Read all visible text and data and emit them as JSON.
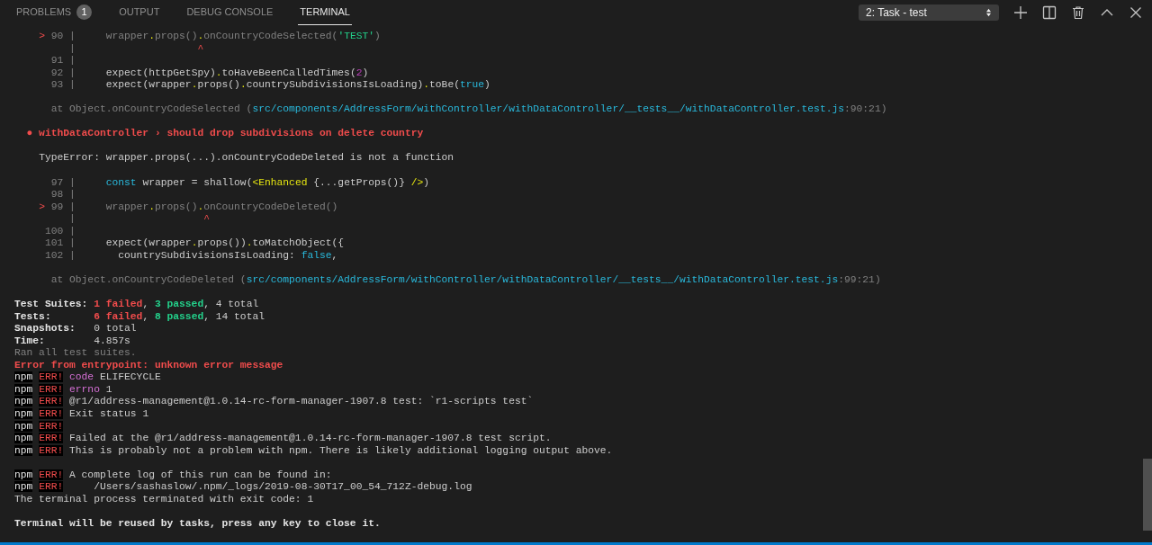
{
  "panel_tabs": [
    {
      "label": "PROBLEMS",
      "badge": "1",
      "selected": false
    },
    {
      "label": "OUTPUT",
      "selected": false
    },
    {
      "label": "DEBUG CONSOLE",
      "selected": false
    },
    {
      "label": "TERMINAL",
      "selected": true
    }
  ],
  "terminal_select": {
    "value": "2: Task - test"
  },
  "terminal_lines": [
    {
      "kind": "text",
      "segments": [
        {
          "kind": "marker",
          "text": "    >"
        },
        {
          "kind": "lineno",
          "text": " 90"
        },
        {
          "kind": "gutter",
          "text": " |"
        },
        {
          "kind": "dimcode",
          "text": "     wrapper"
        },
        {
          "kind": "punct",
          "text": "."
        },
        {
          "kind": "dimcode",
          "text": "props()"
        },
        {
          "kind": "punct",
          "text": "."
        },
        {
          "kind": "dimcode",
          "text": "onCountryCodeSelected("
        },
        {
          "kind": "str",
          "text": "'TEST'"
        },
        {
          "kind": "dimcode",
          "text": ")"
        }
      ]
    },
    {
      "kind": "text",
      "segments": [
        {
          "kind": "gutter",
          "text": "         |"
        },
        {
          "kind": "marker",
          "text": "                    ^"
        }
      ]
    },
    {
      "kind": "text",
      "segments": [
        {
          "kind": "lineno",
          "text": "      91"
        },
        {
          "kind": "gutter",
          "text": " |"
        }
      ]
    },
    {
      "kind": "text",
      "segments": [
        {
          "kind": "lineno",
          "text": "      92"
        },
        {
          "kind": "gutter",
          "text": " |"
        },
        {
          "kind": "code",
          "text": "     expect(httpGetSpy)"
        },
        {
          "kind": "punct",
          "text": "."
        },
        {
          "kind": "code",
          "text": "toHaveBeenCalledTimes("
        },
        {
          "kind": "num",
          "text": "2"
        },
        {
          "kind": "code",
          "text": ")"
        }
      ]
    },
    {
      "kind": "text",
      "segments": [
        {
          "kind": "lineno",
          "text": "      93"
        },
        {
          "kind": "gutter",
          "text": " |"
        },
        {
          "kind": "code",
          "text": "     expect(wrapper"
        },
        {
          "kind": "punct",
          "text": "."
        },
        {
          "kind": "code",
          "text": "props()"
        },
        {
          "kind": "punct",
          "text": "."
        },
        {
          "kind": "code",
          "text": "countrySubdivisionsIsLoading)"
        },
        {
          "kind": "punct",
          "text": "."
        },
        {
          "kind": "code",
          "text": "toBe("
        },
        {
          "kind": "kw",
          "text": "true"
        },
        {
          "kind": "code",
          "text": ")"
        }
      ]
    },
    {
      "kind": "blank"
    },
    {
      "kind": "text",
      "segments": [
        {
          "kind": "dim",
          "text": "      at Object.onCountryCodeSelected ("
        },
        {
          "kind": "path",
          "text": "src/components/AddressForm/withController/withDataController/__tests__/withDataController.test.js"
        },
        {
          "kind": "dim",
          "text": ":90:21)"
        }
      ]
    },
    {
      "kind": "blank"
    },
    {
      "kind": "text",
      "segments": [
        {
          "kind": "redb",
          "text": "  ● withDataController › should drop subdivisions on delete country"
        }
      ]
    },
    {
      "kind": "blank"
    },
    {
      "kind": "text",
      "segments": [
        {
          "kind": "plain",
          "text": "    TypeError: wrapper.props(...).onCountryCodeDeleted is not a function"
        }
      ]
    },
    {
      "kind": "blank"
    },
    {
      "kind": "text",
      "segments": [
        {
          "kind": "lineno",
          "text": "      97"
        },
        {
          "kind": "gutter",
          "text": " |"
        },
        {
          "kind": "kw",
          "text": "     const"
        },
        {
          "kind": "code",
          "text": " wrapper = shallow("
        },
        {
          "kind": "jsx",
          "text": "<Enhanced"
        },
        {
          "kind": "code",
          "text": " {...getProps()} "
        },
        {
          "kind": "jsx",
          "text": "/>"
        },
        {
          "kind": "code",
          "text": ")"
        }
      ]
    },
    {
      "kind": "text",
      "segments": [
        {
          "kind": "lineno",
          "text": "      98"
        },
        {
          "kind": "gutter",
          "text": " |"
        }
      ]
    },
    {
      "kind": "text",
      "segments": [
        {
          "kind": "marker",
          "text": "    >"
        },
        {
          "kind": "lineno",
          "text": " 99"
        },
        {
          "kind": "gutter",
          "text": " |"
        },
        {
          "kind": "dimcode",
          "text": "     wrapper"
        },
        {
          "kind": "punct",
          "text": "."
        },
        {
          "kind": "dimcode",
          "text": "props()"
        },
        {
          "kind": "punct",
          "text": "."
        },
        {
          "kind": "dimcode",
          "text": "onCountryCodeDeleted()"
        }
      ]
    },
    {
      "kind": "text",
      "segments": [
        {
          "kind": "gutter",
          "text": "         |"
        },
        {
          "kind": "marker",
          "text": "                     ^"
        }
      ]
    },
    {
      "kind": "text",
      "segments": [
        {
          "kind": "lineno",
          "text": "     100"
        },
        {
          "kind": "gutter",
          "text": " |"
        }
      ]
    },
    {
      "kind": "text",
      "segments": [
        {
          "kind": "lineno",
          "text": "     101"
        },
        {
          "kind": "gutter",
          "text": " |"
        },
        {
          "kind": "code",
          "text": "     expect(wrapper"
        },
        {
          "kind": "punct",
          "text": "."
        },
        {
          "kind": "code",
          "text": "props())"
        },
        {
          "kind": "punct",
          "text": "."
        },
        {
          "kind": "code",
          "text": "toMatchObject({"
        }
      ]
    },
    {
      "kind": "text",
      "segments": [
        {
          "kind": "lineno",
          "text": "     102"
        },
        {
          "kind": "gutter",
          "text": " |"
        },
        {
          "kind": "code",
          "text": "       countrySubdivisionsIsLoading: "
        },
        {
          "kind": "kw",
          "text": "false"
        },
        {
          "kind": "code",
          "text": ","
        }
      ]
    },
    {
      "kind": "blank"
    },
    {
      "kind": "text",
      "segments": [
        {
          "kind": "dim",
          "text": "      at Object.onCountryCodeDeleted ("
        },
        {
          "kind": "path",
          "text": "src/components/AddressForm/withController/withDataController/__tests__/withDataController.test.js"
        },
        {
          "kind": "dim",
          "text": ":99:21)"
        }
      ]
    },
    {
      "kind": "blank"
    },
    {
      "kind": "text",
      "segments": [
        {
          "kind": "bold",
          "text": "Test Suites: "
        },
        {
          "kind": "redb",
          "text": "1 failed"
        },
        {
          "kind": "plain",
          "text": ", "
        },
        {
          "kind": "greenb",
          "text": "3 passed"
        },
        {
          "kind": "plain",
          "text": ", 4 total"
        }
      ]
    },
    {
      "kind": "text",
      "segments": [
        {
          "kind": "bold",
          "text": "Tests:       "
        },
        {
          "kind": "redb",
          "text": "6 failed"
        },
        {
          "kind": "plain",
          "text": ", "
        },
        {
          "kind": "greenb",
          "text": "8 passed"
        },
        {
          "kind": "plain",
          "text": ", 14 total"
        }
      ]
    },
    {
      "kind": "text",
      "segments": [
        {
          "kind": "bold",
          "text": "Snapshots:   "
        },
        {
          "kind": "plain",
          "text": "0 total"
        }
      ]
    },
    {
      "kind": "text",
      "segments": [
        {
          "kind": "bold",
          "text": "Time:        "
        },
        {
          "kind": "plain",
          "text": "4.857s"
        }
      ]
    },
    {
      "kind": "text",
      "segments": [
        {
          "kind": "dim",
          "text": "Ran all test suites."
        }
      ]
    },
    {
      "kind": "text",
      "segments": [
        {
          "kind": "redb",
          "text": "Error from entrypoint: unknown error message"
        }
      ]
    },
    {
      "kind": "text",
      "segments": [
        {
          "kind": "npm",
          "text": "npm"
        },
        {
          "kind": "badge",
          "text": " ERR!"
        },
        {
          "kind": "magenta",
          "text": " code"
        },
        {
          "kind": "plain",
          "text": " ELIFECYCLE"
        }
      ]
    },
    {
      "kind": "text",
      "segments": [
        {
          "kind": "npm",
          "text": "npm"
        },
        {
          "kind": "badge",
          "text": " ERR!"
        },
        {
          "kind": "magenta",
          "text": " errno"
        },
        {
          "kind": "plain",
          "text": " 1"
        }
      ]
    },
    {
      "kind": "text",
      "segments": [
        {
          "kind": "npm",
          "text": "npm"
        },
        {
          "kind": "badge",
          "text": " ERR!"
        },
        {
          "kind": "plain",
          "text": " @r1/address-management@1.0.14-rc-form-manager-1907.8 test: `r1-scripts test`"
        }
      ]
    },
    {
      "kind": "text",
      "segments": [
        {
          "kind": "npm",
          "text": "npm"
        },
        {
          "kind": "badge",
          "text": " ERR!"
        },
        {
          "kind": "plain",
          "text": " Exit status 1"
        }
      ]
    },
    {
      "kind": "text",
      "segments": [
        {
          "kind": "npm",
          "text": "npm"
        },
        {
          "kind": "badge",
          "text": " ERR!"
        }
      ]
    },
    {
      "kind": "text",
      "segments": [
        {
          "kind": "npm",
          "text": "npm"
        },
        {
          "kind": "badge",
          "text": " ERR!"
        },
        {
          "kind": "plain",
          "text": " Failed at the @r1/address-management@1.0.14-rc-form-manager-1907.8 test script."
        }
      ]
    },
    {
      "kind": "text",
      "segments": [
        {
          "kind": "npm",
          "text": "npm"
        },
        {
          "kind": "badge",
          "text": " ERR!"
        },
        {
          "kind": "plain",
          "text": " This is probably not a problem with npm. There is likely additional logging output above."
        }
      ]
    },
    {
      "kind": "blank"
    },
    {
      "kind": "text",
      "segments": [
        {
          "kind": "npm",
          "text": "npm"
        },
        {
          "kind": "badge",
          "text": " ERR!"
        },
        {
          "kind": "plain",
          "text": " A complete log of this run can be found in:"
        }
      ]
    },
    {
      "kind": "text",
      "segments": [
        {
          "kind": "npm",
          "text": "npm"
        },
        {
          "kind": "badge",
          "text": " ERR!"
        },
        {
          "kind": "plain",
          "text": "     /Users/sashaslow/.npm/_logs/2019-08-30T17_00_54_712Z-debug.log"
        }
      ]
    },
    {
      "kind": "text",
      "segments": [
        {
          "kind": "plain",
          "text": "The terminal process terminated with exit code: 1"
        }
      ]
    },
    {
      "kind": "blank"
    },
    {
      "kind": "text",
      "segments": [
        {
          "kind": "bold",
          "text": "Terminal will be reused by tasks, press any key to close it."
        }
      ]
    }
  ]
}
